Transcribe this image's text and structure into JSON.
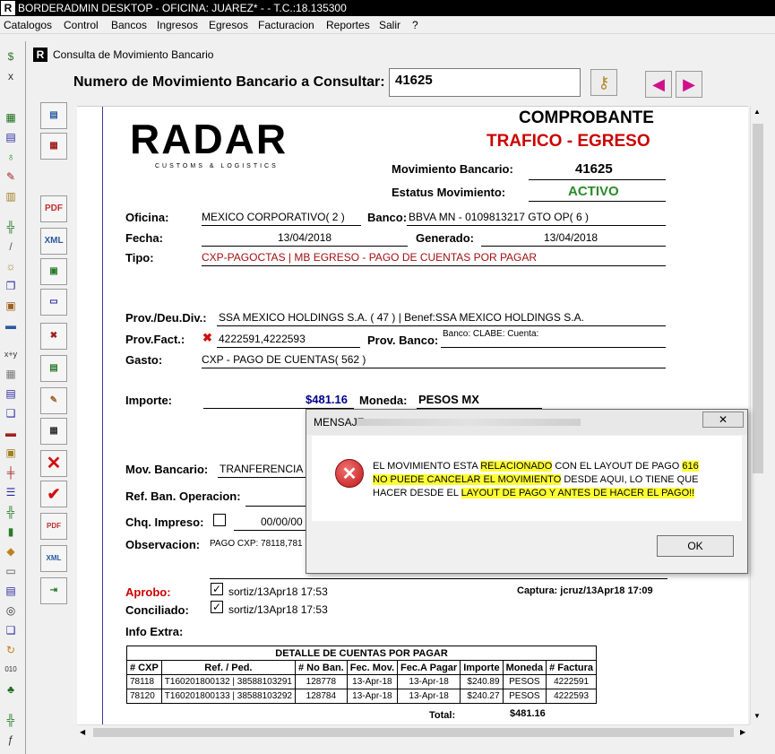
{
  "window": {
    "title": "BORDERADMIN DESKTOP - OFICINA: JUAREZ* -  - T.C.:18.135300"
  },
  "menu": {
    "items": [
      "Catalogos",
      "Control",
      "Bancos",
      "Ingresos",
      "Egresos",
      "Facturacion",
      "Reportes",
      "Salir",
      "?"
    ]
  },
  "child": {
    "title": "Consulta de Movimiento Bancario"
  },
  "query": {
    "label": "Numero de Movimiento Bancario a Consultar:",
    "value": "41625"
  },
  "left_buttons": {
    "pdf": "PDF",
    "xml": "XML",
    "pdf_cp": "PDF CP",
    "xml_cp": "XML CP"
  },
  "doc": {
    "logo_text": "RADAR",
    "logo_sub": "CUSTOMS & LOGISTICS",
    "heading": "COMPROBANTE",
    "subheading": "TRAFICO - EGRESO",
    "mov_label": "Movimiento Bancario:",
    "mov_value": "41625",
    "estatus_label": "Estatus Movimiento:",
    "estatus_value": "ACTIVO",
    "oficina_label": "Oficina:",
    "oficina_value": "MEXICO CORPORATIVO( 2 )",
    "banco_label": "Banco:",
    "banco_value": "BBVA MN - 0109813217 GTO OP( 6 )",
    "fecha_label": "Fecha:",
    "fecha_value": "13/04/2018",
    "generado_label": "Generado:",
    "generado_value": "13/04/2018",
    "tipo_label": "Tipo:",
    "tipo_value": "CXP-PAGOCTAS | MB EGRESO - PAGO DE CUENTAS POR PAGAR",
    "prov_label": "Prov./Deu.Div.:",
    "prov_value": "SSA MEXICO HOLDINGS S.A. ( 47 ) | Benef:SSA MEXICO HOLDINGS S.A.",
    "provfact_label": "Prov.Fact.:",
    "provfact_value": "4222591,4222593",
    "provbanco_label": "Prov. Banco:",
    "provbanco_value": "Banco: CLABE: Cuenta:",
    "gasto_label": "Gasto:",
    "gasto_value": "CXP - PAGO DE CUENTAS( 562 )",
    "importe_label": "Importe:",
    "importe_value": "$481.16",
    "moneda_label": "Moneda:",
    "moneda_value": "PESOS MX",
    "movbanc_label": "Mov. Bancario:",
    "movbanc_value": "TRANFERENCIA",
    "refban_label": "Ref. Ban. Operacion:",
    "chq_label": "Chq. Impreso:",
    "chq_value": "00/00/00",
    "obs_label": "Observacion:",
    "obs_value": "PAGO CXP: 78118,781",
    "aprobo_label": "Aprobo:",
    "aprobo_value": "sortiz/13Apr18 17:53",
    "captura_value": "Captura: jcruz/13Apr18 17:09",
    "conciliado_label": "Conciliado:",
    "conciliado_value": "sortiz/13Apr18 17:53",
    "info_label": "Info Extra:"
  },
  "detalle": {
    "title": "DETALLE DE CUENTAS POR PAGAR",
    "headers": [
      "# CXP",
      "Ref. / Ped.",
      "# No Ban.",
      "Fec. Mov.",
      "Fec.A Pagar",
      "Importe",
      "Moneda",
      "# Factura"
    ],
    "rows": [
      [
        "78118",
        "T160201800132 | 38588103291",
        "128778",
        "13-Apr-18",
        "13-Apr-18",
        "$240.89",
        "PESOS",
        "4222591"
      ],
      [
        "78120",
        "T160201800133 | 38588103292",
        "128784",
        "13-Apr-18",
        "13-Apr-18",
        "$240.27",
        "PESOS",
        "4222593"
      ]
    ],
    "total_label": "Total:",
    "total_value": "$481.16"
  },
  "dialog": {
    "title": "MENSAJE",
    "close_label": "✕",
    "msg_1": "EL MOVIMIENTO ESTA ",
    "msg_2": "RELACIONADO",
    "msg_3": " CON EL LAYOUT DE PAGO ",
    "msg_4": "616",
    "msg_5": "NO PUEDE CANCELAR EL MOVIMIENTO",
    "msg_6": " DESDE AQUI, LO TIENE QUE HACER DESDE EL ",
    "msg_7": "LAYOUT DE PAGO Y ANTES DE HACER EL PAGO!!",
    "ok_label": "OK"
  },
  "colors": {
    "accent_red": "#cc0000",
    "accent_green": "#2a8a2a",
    "highlight": "#ffff33",
    "blue_value": "#00008b"
  }
}
